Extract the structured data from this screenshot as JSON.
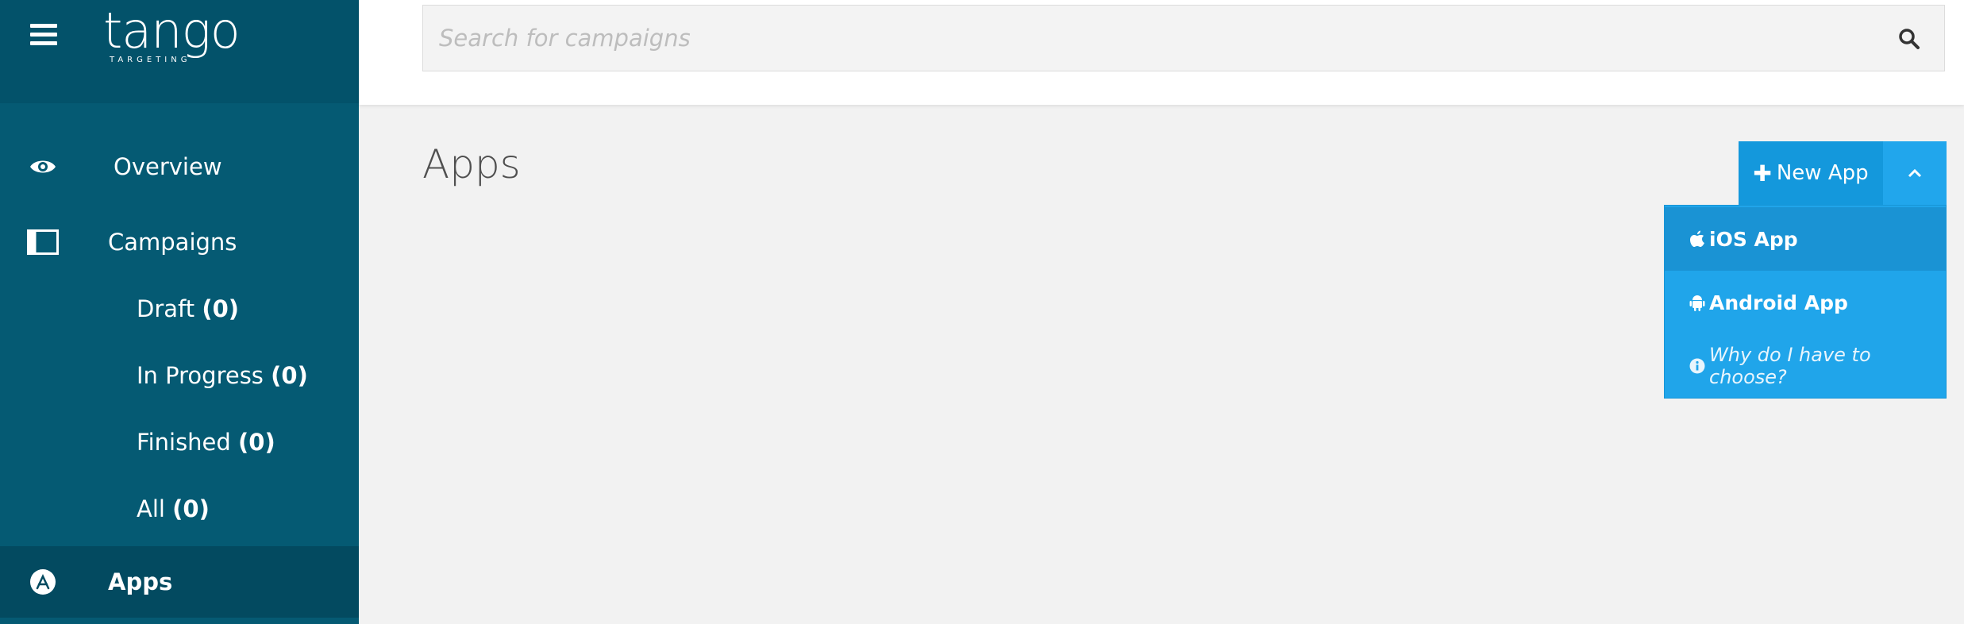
{
  "brand": {
    "logo_text": "tango",
    "logo_sub": "TARGETING"
  },
  "search": {
    "placeholder": "Search for campaigns",
    "value": ""
  },
  "sidebar": {
    "overview_label": "Overview",
    "campaigns_label": "Campaigns",
    "sub_items": [
      {
        "label": "Draft",
        "count": "(0)"
      },
      {
        "label": "In Progress",
        "count": "(0)"
      },
      {
        "label": "Finished",
        "count": "(0)"
      },
      {
        "label": "All",
        "count": "(0)"
      }
    ],
    "apps_label": "Apps"
  },
  "main": {
    "title": "Apps",
    "new_app_label": "New App",
    "dropdown": {
      "ios_label": "iOS App",
      "android_label": "Android App",
      "why_label": "Why do I have to choose?"
    }
  },
  "colors": {
    "sidebar_bg": "#055a73",
    "sidebar_active": "#034a60",
    "primary_button": "#1498dc",
    "dropdown_bg": "#20a5ea",
    "page_bg": "#f2f2f2"
  }
}
